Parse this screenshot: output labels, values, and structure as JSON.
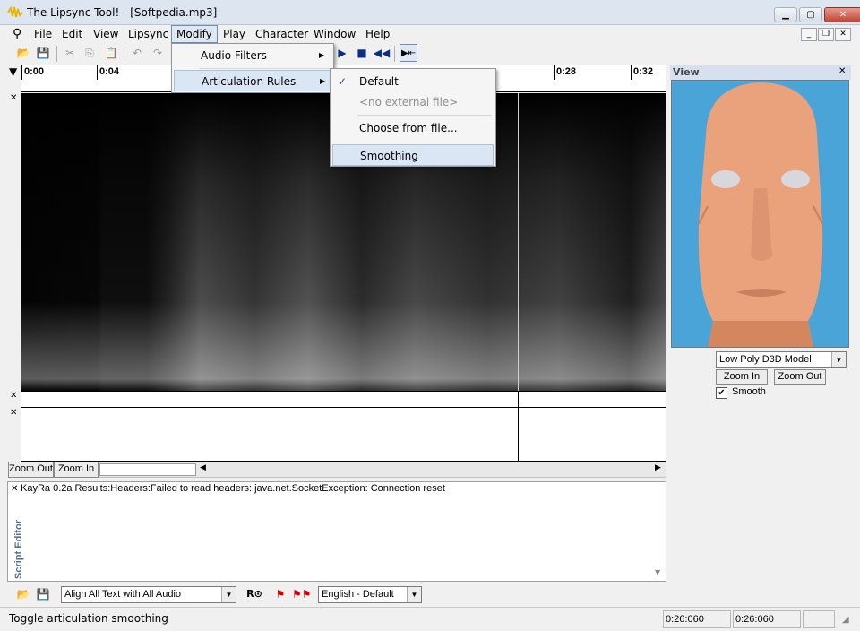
{
  "window": {
    "title": "The Lipsync Tool! - [Softpedia.mp3]"
  },
  "menu": {
    "items": [
      "File",
      "Edit",
      "View",
      "Lipsync",
      "Modify",
      "Play",
      "Character",
      "Window",
      "Help"
    ]
  },
  "modify_menu": {
    "audio_filters": "Audio Filters",
    "articulation_rules": "Articulation Rules"
  },
  "submenu": {
    "default": "Default",
    "no_external": "<no external file>",
    "choose": "Choose from file...",
    "smoothing": "Smoothing"
  },
  "timeline": {
    "labels": [
      "0:00",
      "0:04",
      "0:28",
      "0:32"
    ]
  },
  "view_panel": {
    "title": "View",
    "model_select": "Low Poly D3D Model",
    "zoom_in": "Zoom In",
    "zoom_out": "Zoom Out",
    "smooth_label": "Smooth",
    "bg_color": "#4aa4d8",
    "face_color": "#e9a27c"
  },
  "wave_controls": {
    "zoom_out": "Zoom Out",
    "zoom_in": "Zoom In"
  },
  "script_editor": {
    "title": "Script Editor",
    "text": "KayRa 0.2a Results:Headers:Failed to read headers: java.net.SocketException: Connection reset"
  },
  "bottom_toolbar": {
    "align_select": "Align All Text with All Audio",
    "language_select": "English - Default"
  },
  "status": {
    "message": "Toggle articulation smoothing",
    "time1": "0:26:060",
    "time2": "0:26:060"
  }
}
